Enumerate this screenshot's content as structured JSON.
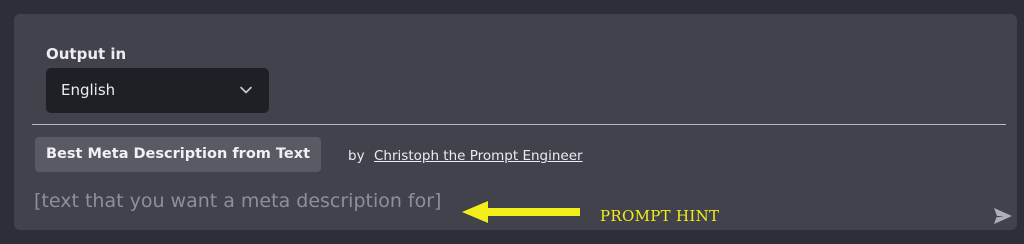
{
  "output": {
    "label": "Output in",
    "language": "English"
  },
  "prompt": {
    "title": "Best Meta Description from Text",
    "by": "by",
    "author": "Christoph the Prompt Engineer",
    "placeholder": "[text that you want a meta description for]"
  },
  "annotation": {
    "hint": "PROMPT  HINT",
    "color": "#f3ee1a"
  },
  "icons": {
    "select": "chevron-down-icon",
    "send": "send-icon",
    "annotation": "arrow-left-icon"
  }
}
